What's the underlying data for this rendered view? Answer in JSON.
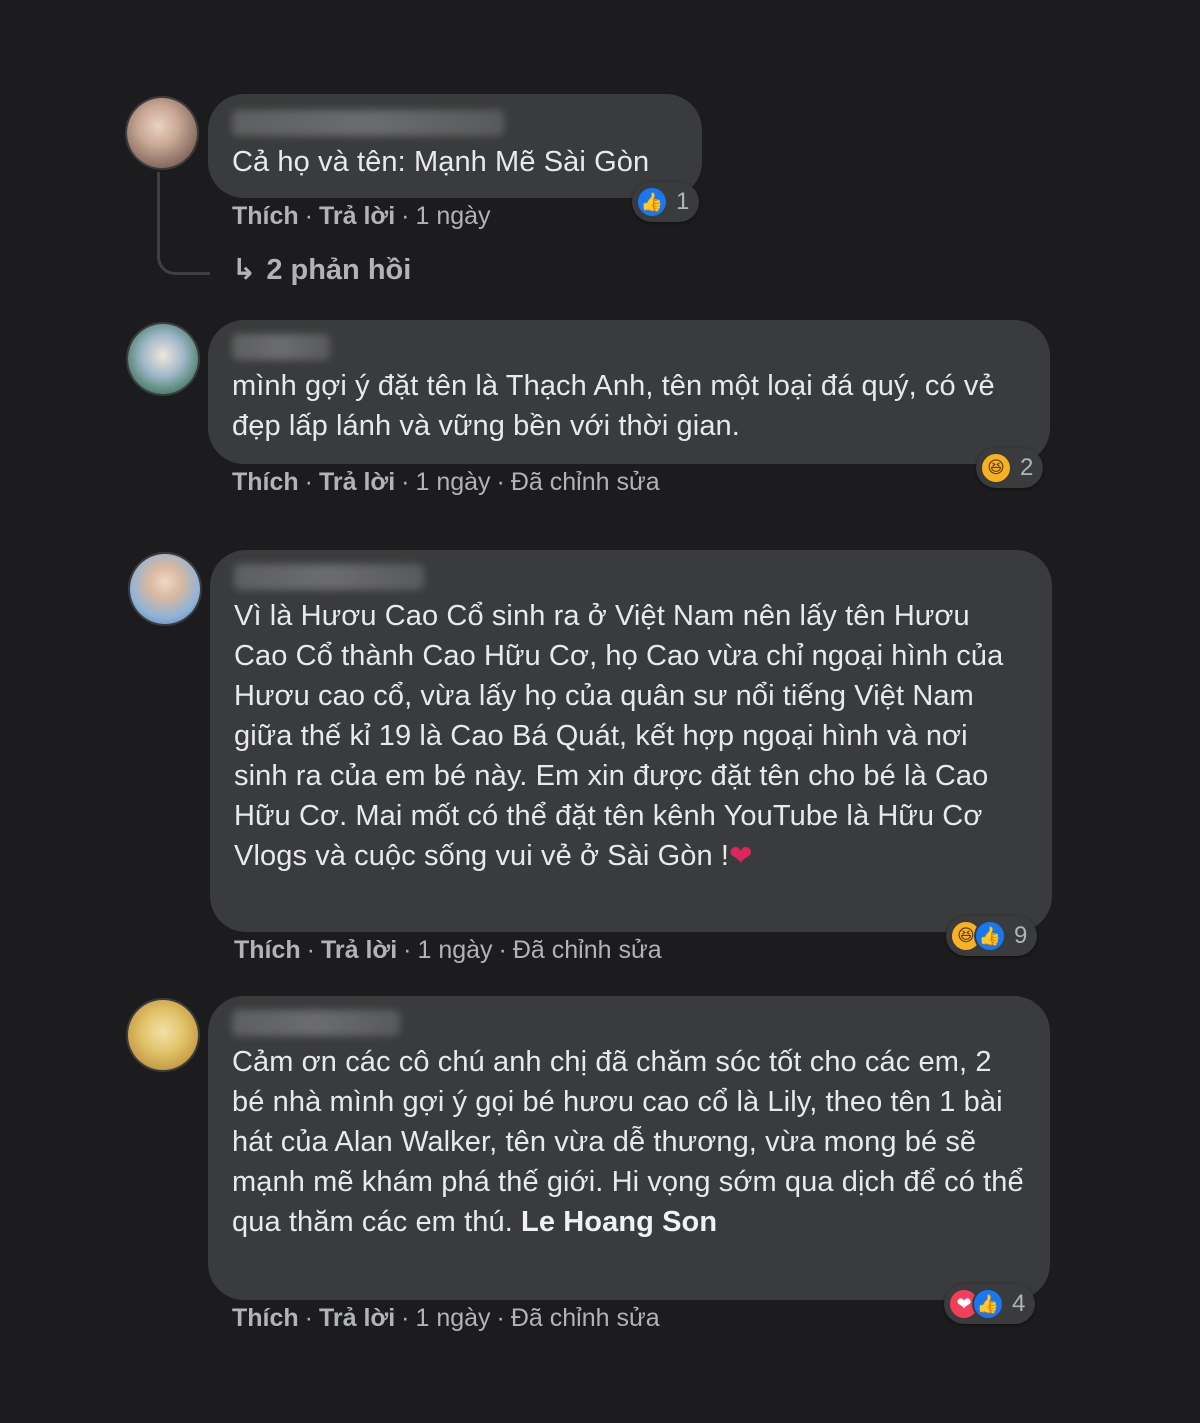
{
  "comments": [
    {
      "text": "Cả họ và tên: Mạnh Mẽ Sài Gòn",
      "like_label": "Thích",
      "reply_label": "Trả lời",
      "time": "1 ngày",
      "edited": "",
      "reaction_count": "1",
      "reactions": [
        "like-icon"
      ]
    },
    {
      "text": "mình gợi ý đặt tên là Thạch Anh, tên một loại đá quý, có vẻ đẹp lấp lánh và vững bền với thời gian.",
      "like_label": "Thích",
      "reply_label": "Trả lời",
      "time": "1 ngày",
      "edited": "Đã chỉnh sửa",
      "reaction_count": "2",
      "reactions": [
        "haha-icon"
      ]
    },
    {
      "text": "Vì là Hươu Cao Cổ sinh ra ở Việt Nam nên lấy tên Hươu Cao Cổ thành Cao Hữu Cơ, họ Cao vừa chỉ ngoại hình của Hươu cao cổ, vừa lấy họ của quân sư nổi tiếng Việt Nam giữa thế kỉ 19 là Cao Bá Quát, kết hợp ngoại hình và nơi sinh ra của em bé này. Em xin được đặt tên cho bé là Cao Hữu Cơ. Mai mốt có thể đặt tên kênh YouTube là Hữu Cơ Vlogs và cuộc sống vui vẻ ở Sài Gòn !",
      "like_label": "Thích",
      "reply_label": "Trả lời",
      "time": "1 ngày",
      "edited": "Đã chỉnh sửa",
      "reaction_count": "9",
      "reactions": [
        "haha-icon",
        "like-icon"
      ]
    },
    {
      "text": "Cảm ơn các cô chú anh chị đã chăm sóc tốt cho các em, 2 bé nhà mình gợi ý gọi bé hươu cao cổ là Lily, theo tên 1 bài hát của Alan Walker, tên vừa dễ thương, vừa mong bé sẽ mạnh mẽ khám phá thế giới. Hi vọng sớm qua dịch để có thể qua thăm các em thú. ",
      "mention": "Le Hoang Son",
      "like_label": "Thích",
      "reply_label": "Trả lời",
      "time": "1 ngày",
      "edited": "Đã chỉnh sửa",
      "reaction_count": "4",
      "reactions": [
        "love-icon",
        "like-icon"
      ]
    }
  ],
  "replies_link": "2 phản hồi",
  "colors": {
    "background": "#1c1c1e",
    "bubble": "#3a3b3c",
    "text": "#e8e9ec",
    "meta": "#b0b3b8",
    "like": "#1877f2",
    "haha": "#f7b125",
    "love": "#f33e58"
  }
}
